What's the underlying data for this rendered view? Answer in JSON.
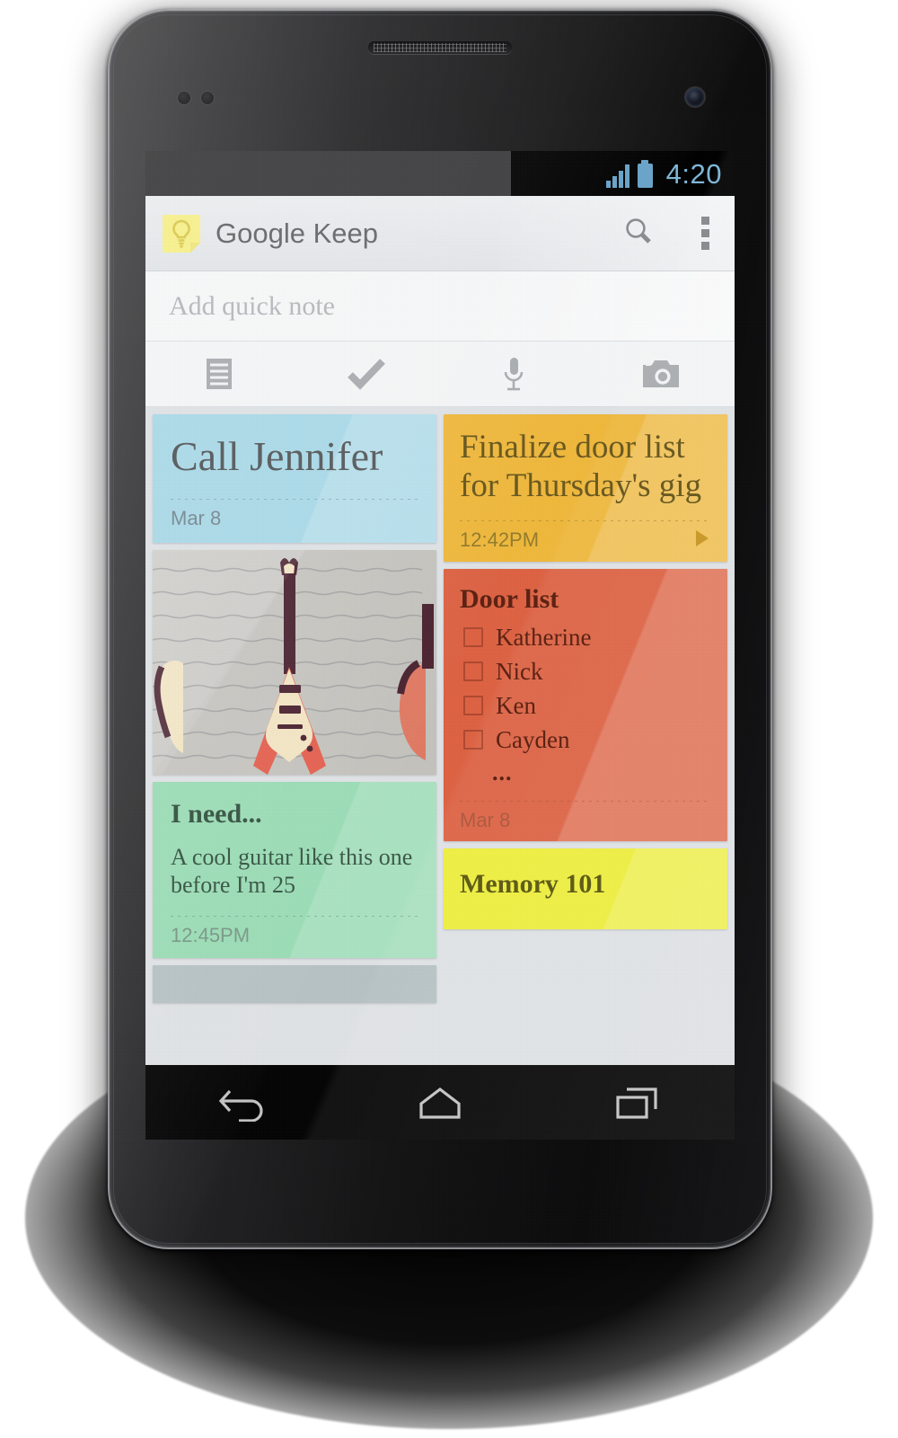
{
  "device": {
    "name": "android-phone",
    "earpiece": "earpiece-speaker",
    "front_camera": "front-camera"
  },
  "status_bar": {
    "time": "4:20",
    "signal_icon": "signal-bars-icon",
    "battery_icon": "battery-full-icon",
    "time_color": "#7fb6d6"
  },
  "app_bar": {
    "logo_icon": "keep-lightbulb-icon",
    "title": "Google Keep",
    "search_icon": "search-icon",
    "overflow_icon": "overflow-menu-icon"
  },
  "quick_note": {
    "placeholder": "Add quick note",
    "actions": [
      {
        "name": "new-note-icon",
        "label": "Note"
      },
      {
        "name": "new-list-icon",
        "label": "List"
      },
      {
        "name": "voice-note-icon",
        "label": "Voice"
      },
      {
        "name": "photo-note-icon",
        "label": "Photo"
      }
    ]
  },
  "notes": {
    "left_column": [
      {
        "id": "note-call-jennifer",
        "kind": "text",
        "title": "Call Jennifer",
        "timestamp": "Mar 8",
        "color": "#a9d9e8",
        "text_color": "#5e6163",
        "time_color": "#7e8f96"
      },
      {
        "id": "note-guitar-photo",
        "kind": "photo",
        "alt": "guitars-on-wall-illustration",
        "color": "#c9c8c4"
      },
      {
        "id": "note-i-need",
        "kind": "text",
        "title": "I need...",
        "body": "A cool guitar like this one before I'm 25",
        "timestamp": "12:45PM",
        "color": "#9adcb5",
        "text_color": "#3d5a4a",
        "time_color": "#7d9b8a"
      },
      {
        "id": "note-partial-bottom",
        "kind": "partial",
        "color": "#b6c2c4"
      }
    ],
    "right_column": [
      {
        "id": "note-finalize-door-list",
        "kind": "text",
        "title": "Finalize door list for Thursday's gig",
        "timestamp": "12:42PM",
        "has_reminder_arrow": true,
        "reminder_icon": "play-triangle-icon",
        "color": "#efb83c",
        "text_color": "#6a5a22",
        "time_color": "#927c2f"
      },
      {
        "id": "note-door-list",
        "kind": "checklist",
        "title": "Door list",
        "items": [
          "Katherine",
          "Nick",
          "Ken",
          "Cayden"
        ],
        "overflow_indicator": "...",
        "timestamp": "Mar 8",
        "color": "#dd6243",
        "text_color": "#5c2314",
        "time_color": "#a0533c"
      },
      {
        "id": "note-memory-101",
        "kind": "text",
        "title": "Memory 101",
        "color": "#eeee3c",
        "text_color": "#5f5d18"
      }
    ]
  },
  "nav_bar": {
    "buttons": [
      {
        "name": "back-button",
        "icon": "back-arrow-icon"
      },
      {
        "name": "home-button",
        "icon": "home-icon"
      },
      {
        "name": "recents-button",
        "icon": "recent-apps-icon"
      }
    ]
  }
}
